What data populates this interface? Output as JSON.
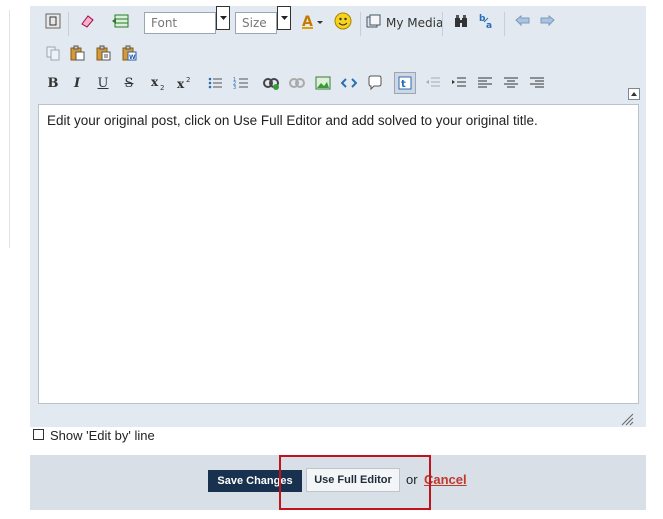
{
  "toolbar": {
    "font_placeholder": "Font",
    "size_placeholder": "Size",
    "my_media_label": "My Media",
    "row1_icons": [
      "switch-mode-icon",
      "eraser-icon",
      "insert-table-icon"
    ],
    "row1_icons_b": [
      "text-color-icon",
      "smiley-icon"
    ],
    "row1_icons_c": [
      "binoculars-icon",
      "replace-icon",
      "undo-icon",
      "redo-icon"
    ],
    "row2_icons": [
      "copy-icon",
      "paste-icon",
      "paste-text-icon",
      "paste-word-icon"
    ],
    "row3_labels": {
      "bold": "B",
      "italic": "I",
      "underline": "U",
      "strike": "S"
    }
  },
  "editor": {
    "content": "Edit your original post, click on Use Full Editor and add solved to your original title."
  },
  "options": {
    "edit_by_label": "Show 'Edit by' line"
  },
  "actions": {
    "save_label": "Save Changes",
    "full_editor_label": "Use Full Editor",
    "or_label": "or",
    "cancel_label": "Cancel"
  },
  "colors": {
    "panel": "#e3e9f0",
    "save_button": "#17314f",
    "cancel_link": "#c0392b",
    "highlight": "#c0141a"
  }
}
